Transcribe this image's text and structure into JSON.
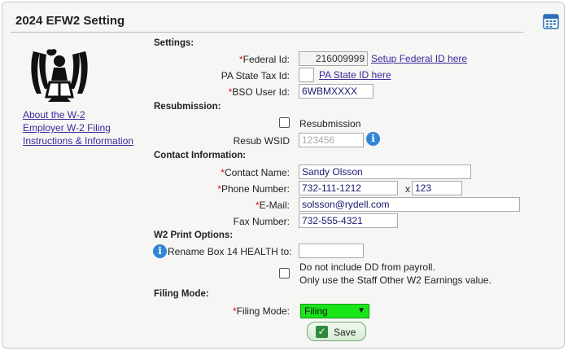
{
  "page": {
    "title": "2024 EFW2 Setting"
  },
  "icons": {
    "calendar": "calendar-icon",
    "logo": "irs-eagle-logo",
    "info": "info-icon",
    "save_check": "check-icon"
  },
  "colors": {
    "link": "#3a2a9e",
    "required": "#dd1111",
    "filing_select": "#19e619",
    "info": "#2f86d6"
  },
  "sidebar": {
    "links": [
      "About the W-2",
      "Employer W-2 Filing",
      "Instructions & Information"
    ]
  },
  "settings": {
    "heading": "Settings:",
    "federal_id": {
      "label": "Federal Id:",
      "value": "216009999",
      "link": "Setup Federal ID here"
    },
    "pa_state_tax_id": {
      "label": "PA State Tax Id:",
      "value": "",
      "link": "PA State ID here"
    },
    "bso_user_id": {
      "label": "BSO User Id:",
      "value": "6WBMXXXX"
    }
  },
  "resubmission": {
    "heading": "Resubmission:",
    "checkbox_label": "Resubmission",
    "checked": false,
    "wsid_label": "Resub WSID",
    "wsid_value": "123456"
  },
  "contact": {
    "heading": "Contact Information:",
    "name": {
      "label": "Contact Name:",
      "value": "Sandy Olsson"
    },
    "phone": {
      "label": "Phone Number:",
      "value": "732-111-1212",
      "ext_sep": "x",
      "ext": "123"
    },
    "email": {
      "label": "E-Mail:",
      "value": "solsson@rydell.com"
    },
    "fax": {
      "label": "Fax Number:",
      "value": "732-555-4321"
    }
  },
  "print_options": {
    "heading": "W2 Print Options:",
    "rename_label": "Rename Box 14 HEALTH to:",
    "rename_value": "",
    "dd_line1": "Do not include DD from payroll.",
    "dd_line2": "Only use the Staff Other W2 Earnings value.",
    "dd_checked": false
  },
  "filing_mode": {
    "heading": "Filing Mode:",
    "label": "Filing Mode:",
    "selected": "Filing"
  },
  "actions": {
    "save": "Save"
  },
  "required_mark": "*"
}
